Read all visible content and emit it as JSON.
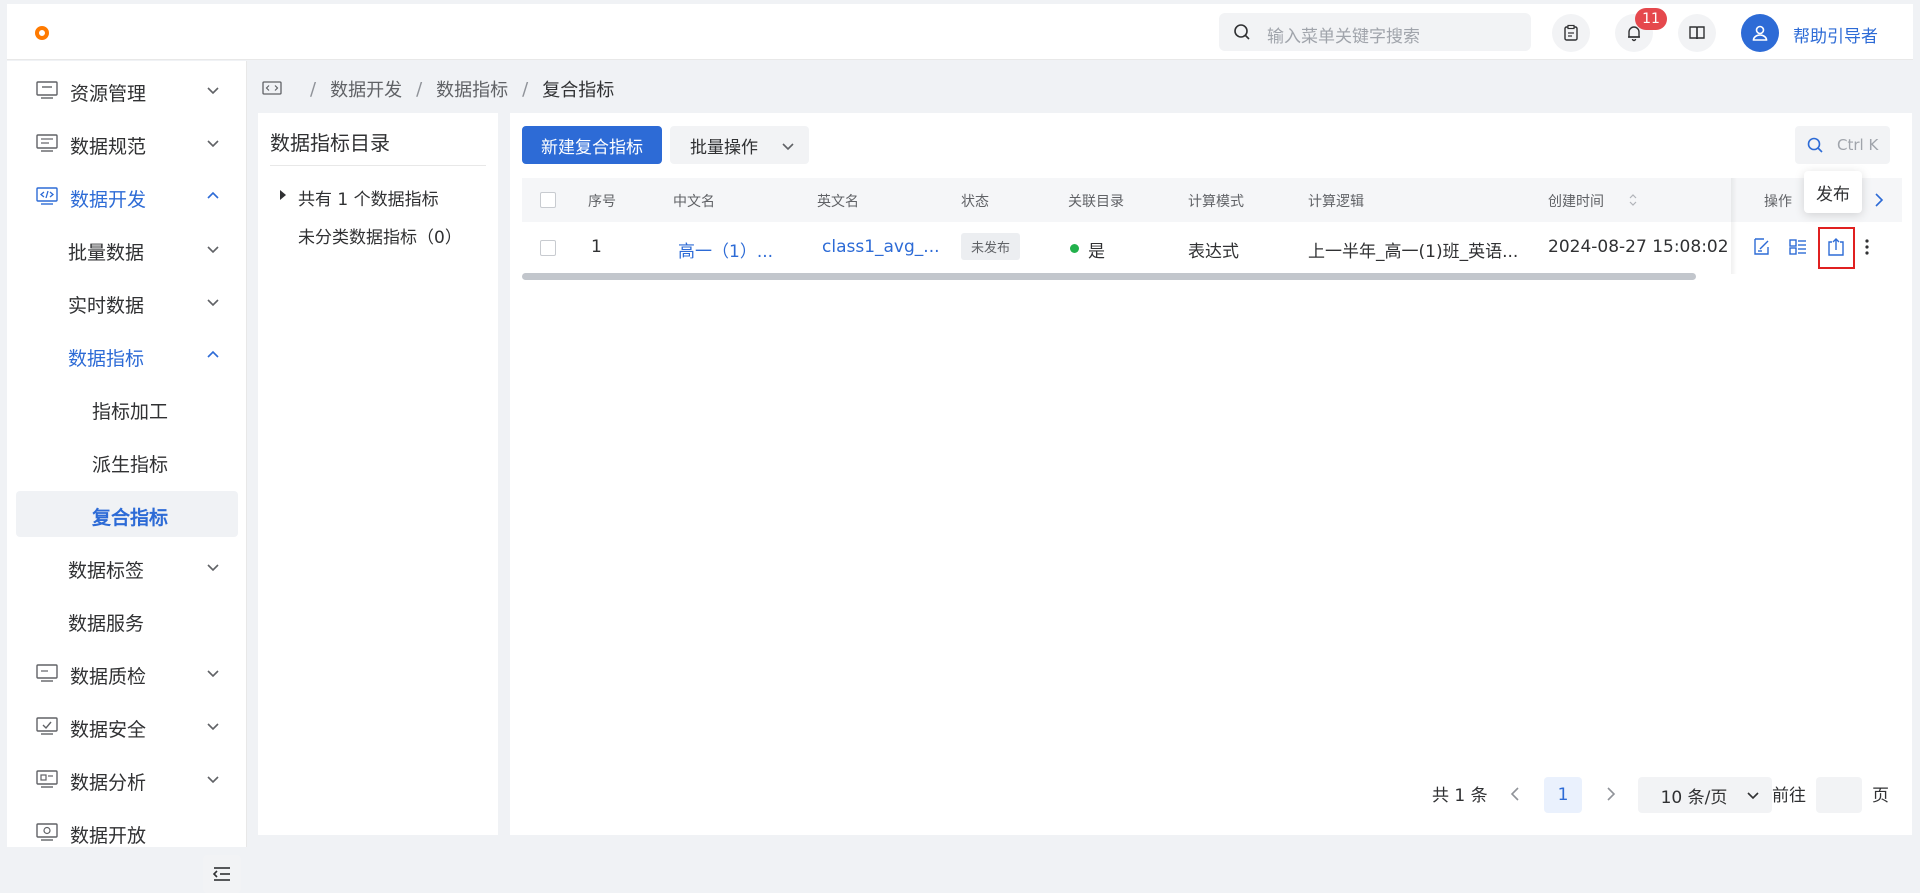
{
  "header": {
    "search_placeholder": "输入菜单关键字搜索",
    "notification_count": "11",
    "username": "帮助引导者",
    "accent_color": "#2d6bd6"
  },
  "sidebar": {
    "items": [
      {
        "label": "资源管理",
        "icon": "server-icon",
        "level": 0
      },
      {
        "label": "数据规范",
        "icon": "standard-icon",
        "level": 0
      },
      {
        "label": "数据开发",
        "icon": "code-icon",
        "level": 0,
        "active": true,
        "expanded": true
      },
      {
        "label": "批量数据",
        "level": 1
      },
      {
        "label": "实时数据",
        "level": 1
      },
      {
        "label": "数据指标",
        "level": 1,
        "active": true,
        "expanded": true
      },
      {
        "label": "指标加工",
        "level": 2
      },
      {
        "label": "派生指标",
        "level": 2
      },
      {
        "label": "复合指标",
        "level": 2,
        "selected": true
      },
      {
        "label": "数据标签",
        "level": 1
      },
      {
        "label": "数据服务",
        "level": 1
      },
      {
        "label": "数据质检",
        "icon": "quality-icon",
        "level": 0
      },
      {
        "label": "数据安全",
        "icon": "security-icon",
        "level": 0
      },
      {
        "label": "数据分析",
        "icon": "analysis-icon",
        "level": 0
      },
      {
        "label": "数据开放",
        "icon": "open-icon",
        "level": 0
      }
    ]
  },
  "breadcrumb": [
    "数据开发",
    "数据指标",
    "复合指标"
  ],
  "catalog": {
    "title": "数据指标目录",
    "summary": "共有 1 个数据指标",
    "uncategorized": "未分类数据指标（0）"
  },
  "toolbar": {
    "new_button": "新建复合指标",
    "batch_button": "批量操作",
    "search_placeholder": "Ctrl K"
  },
  "table": {
    "columns": [
      "序号",
      "中文名",
      "英文名",
      "状态",
      "关联目录",
      "计算模式",
      "计算逻辑",
      "创建时间",
      "操作"
    ],
    "rows": [
      {
        "index": "1",
        "cn_name": "高一（1）...",
        "en_name": "class1_avg_...",
        "status": "未发布",
        "linked": "是",
        "mode": "表达式",
        "logic": "上一半年_高一(1)班_英语...",
        "created": "2024-08-27 15:08:02"
      }
    ],
    "tooltip": "发布"
  },
  "pagination": {
    "total": "共 1 条",
    "current_page": "1",
    "page_size": "10 条/页",
    "goto_label": "前往",
    "page_suffix": "页"
  }
}
